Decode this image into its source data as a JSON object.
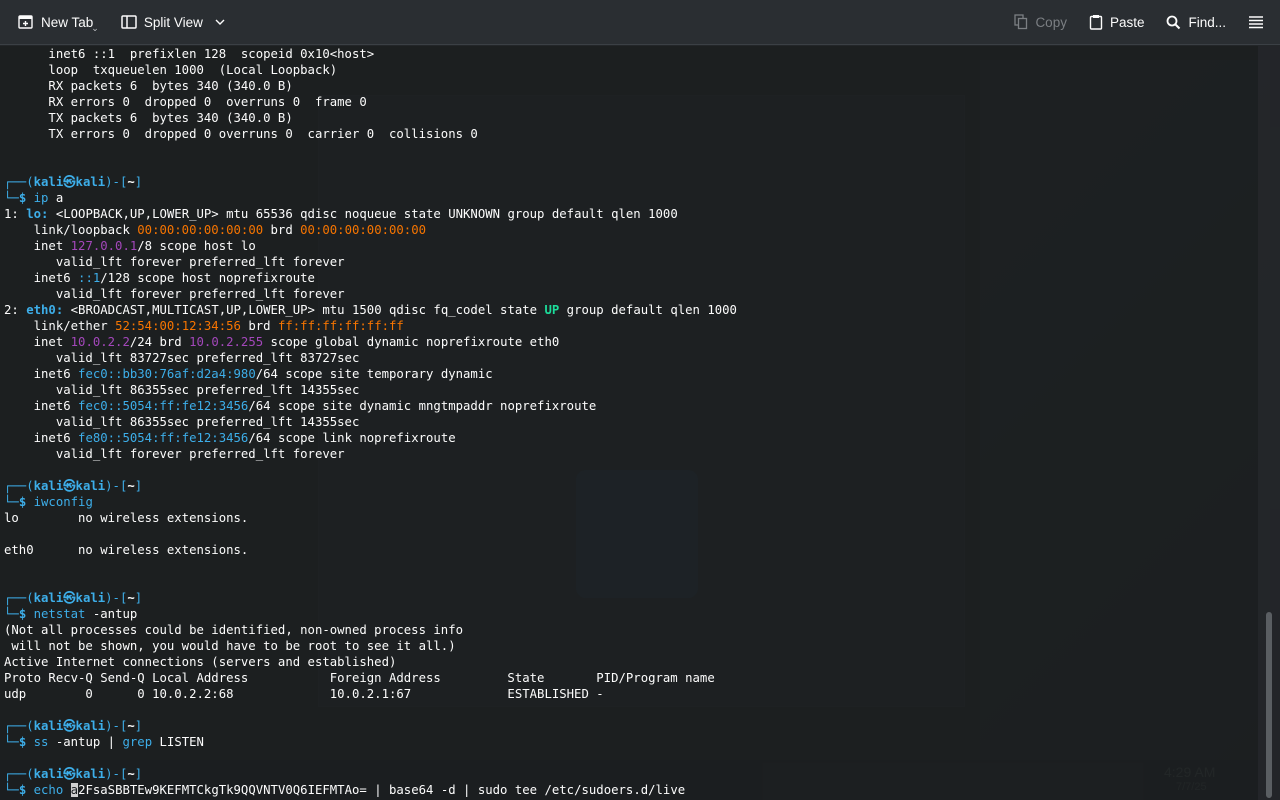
{
  "toolbar": {
    "new_tab": "New Tab",
    "split_view": "Split View",
    "copy": "Copy",
    "paste": "Paste",
    "find": "Find...",
    "icons": [
      "new-tab-icon",
      "split-view-icon",
      "chevron-down-icon",
      "copy-icon",
      "paste-icon",
      "search-icon",
      "hamburger-menu-icon"
    ]
  },
  "background": {
    "clock": "4:29 AM",
    "date": "7/7/25"
  },
  "terminal": {
    "lines": [
      [
        {
          "t": "      inet6 ::1  prefixlen 128  scopeid 0x10<host>"
        }
      ],
      [
        {
          "t": "      loop  txqueuelen 1000  (Local Loopback)"
        }
      ],
      [
        {
          "t": "      RX packets 6  bytes 340 (340.0 B)"
        }
      ],
      [
        {
          "t": "      RX errors 0  dropped 0  overruns 0  frame 0"
        }
      ],
      [
        {
          "t": "      TX packets 6  bytes 340 (340.0 B)"
        }
      ],
      [
        {
          "t": "      TX errors 0  dropped 0 overruns 0  carrier 0  collisions 0"
        }
      ],
      [
        {
          "t": ""
        }
      ],
      [
        {
          "t": ""
        }
      ],
      [
        {
          "t": "┌──(",
          "c": "c-b"
        },
        {
          "t": "kali㉿kali",
          "c": "c-bb"
        },
        {
          "t": ")-[",
          "c": "c-b"
        },
        {
          "t": "~",
          "c": "bold"
        },
        {
          "t": "]",
          "c": "c-b"
        }
      ],
      [
        {
          "t": "└─",
          "c": "c-b"
        },
        {
          "t": "$ ",
          "c": "c-bb"
        },
        {
          "t": "ip",
          "c": "c-b"
        },
        {
          "t": " a"
        }
      ],
      [
        {
          "t": "1: "
        },
        {
          "t": "lo:",
          "c": "c-bb"
        },
        {
          "t": " <LOOPBACK,UP,LOWER_UP> mtu 65536 qdisc noqueue state UNKNOWN group default qlen 1000"
        }
      ],
      [
        {
          "t": "    link/loopback "
        },
        {
          "t": "00:00:00:00:00:00",
          "c": "c-o"
        },
        {
          "t": " brd "
        },
        {
          "t": "00:00:00:00:00:00",
          "c": "c-o"
        }
      ],
      [
        {
          "t": "    inet "
        },
        {
          "t": "127.0.0.1",
          "c": "c-p"
        },
        {
          "t": "/8 scope host lo"
        }
      ],
      [
        {
          "t": "       valid_lft forever preferred_lft forever"
        }
      ],
      [
        {
          "t": "    inet6 "
        },
        {
          "t": "::1",
          "c": "c-b"
        },
        {
          "t": "/128 scope host noprefixroute"
        }
      ],
      [
        {
          "t": "       valid_lft forever preferred_lft forever"
        }
      ],
      [
        {
          "t": "2: "
        },
        {
          "t": "eth0:",
          "c": "c-bb"
        },
        {
          "t": " <BROADCAST,MULTICAST,UP,LOWER_UP> mtu 1500 qdisc fq_codel state "
        },
        {
          "t": "UP",
          "c": "c-g"
        },
        {
          "t": " group default qlen 1000"
        }
      ],
      [
        {
          "t": "    link/ether "
        },
        {
          "t": "52:54:00:12:34:56",
          "c": "c-o"
        },
        {
          "t": " brd "
        },
        {
          "t": "ff:ff:ff:ff:ff:ff",
          "c": "c-o"
        }
      ],
      [
        {
          "t": "    inet "
        },
        {
          "t": "10.0.2.2",
          "c": "c-p"
        },
        {
          "t": "/24 brd "
        },
        {
          "t": "10.0.2.255",
          "c": "c-p"
        },
        {
          "t": " scope global dynamic noprefixroute eth0"
        }
      ],
      [
        {
          "t": "       valid_lft 83727sec preferred_lft 83727sec"
        }
      ],
      [
        {
          "t": "    inet6 "
        },
        {
          "t": "fec0::bb30:76af:d2a4:980",
          "c": "c-b"
        },
        {
          "t": "/64 scope site temporary dynamic"
        }
      ],
      [
        {
          "t": "       valid_lft 86355sec preferred_lft 14355sec"
        }
      ],
      [
        {
          "t": "    inet6 "
        },
        {
          "t": "fec0::5054:ff:fe12:3456",
          "c": "c-b"
        },
        {
          "t": "/64 scope site dynamic mngtmpaddr noprefixroute"
        }
      ],
      [
        {
          "t": "       valid_lft 86355sec preferred_lft 14355sec"
        }
      ],
      [
        {
          "t": "    inet6 "
        },
        {
          "t": "fe80::5054:ff:fe12:3456",
          "c": "c-b"
        },
        {
          "t": "/64 scope link noprefixroute"
        }
      ],
      [
        {
          "t": "       valid_lft forever preferred_lft forever"
        }
      ],
      [
        {
          "t": ""
        }
      ],
      [
        {
          "t": "┌──(",
          "c": "c-b"
        },
        {
          "t": "kali㉿kali",
          "c": "c-bb"
        },
        {
          "t": ")-[",
          "c": "c-b"
        },
        {
          "t": "~",
          "c": "bold"
        },
        {
          "t": "]",
          "c": "c-b"
        }
      ],
      [
        {
          "t": "└─",
          "c": "c-b"
        },
        {
          "t": "$ ",
          "c": "c-bb"
        },
        {
          "t": "iwconfig",
          "c": "c-b"
        }
      ],
      [
        {
          "t": "lo        no wireless extensions."
        }
      ],
      [
        {
          "t": ""
        }
      ],
      [
        {
          "t": "eth0      no wireless extensions."
        }
      ],
      [
        {
          "t": ""
        }
      ],
      [
        {
          "t": ""
        }
      ],
      [
        {
          "t": "┌──(",
          "c": "c-b"
        },
        {
          "t": "kali㉿kali",
          "c": "c-bb"
        },
        {
          "t": ")-[",
          "c": "c-b"
        },
        {
          "t": "~",
          "c": "bold"
        },
        {
          "t": "]",
          "c": "c-b"
        }
      ],
      [
        {
          "t": "└─",
          "c": "c-b"
        },
        {
          "t": "$ ",
          "c": "c-bb"
        },
        {
          "t": "netstat",
          "c": "c-b"
        },
        {
          "t": " -antup"
        }
      ],
      [
        {
          "t": "(Not all processes could be identified, non-owned process info"
        }
      ],
      [
        {
          "t": " will not be shown, you would have to be root to see it all.)"
        }
      ],
      [
        {
          "t": "Active Internet connections (servers and established)"
        }
      ],
      [
        {
          "t": "Proto Recv-Q Send-Q Local Address           Foreign Address         State       PID/Program name"
        }
      ],
      [
        {
          "t": "udp        0      0 10.0.2.2:68             10.0.2.1:67             ESTABLISHED -"
        }
      ],
      [
        {
          "t": ""
        }
      ],
      [
        {
          "t": "┌──(",
          "c": "c-b"
        },
        {
          "t": "kali㉿kali",
          "c": "c-bb"
        },
        {
          "t": ")-[",
          "c": "c-b"
        },
        {
          "t": "~",
          "c": "bold"
        },
        {
          "t": "]",
          "c": "c-b"
        }
      ],
      [
        {
          "t": "└─",
          "c": "c-b"
        },
        {
          "t": "$ ",
          "c": "c-bb"
        },
        {
          "t": "ss",
          "c": "c-b"
        },
        {
          "t": " -antup | "
        },
        {
          "t": "grep",
          "c": "c-b"
        },
        {
          "t": " LISTEN"
        }
      ],
      [
        {
          "t": ""
        }
      ],
      [
        {
          "t": "┌──(",
          "c": "c-b"
        },
        {
          "t": "kali㉿kali",
          "c": "c-bb"
        },
        {
          "t": ")-[",
          "c": "c-b"
        },
        {
          "t": "~",
          "c": "bold"
        },
        {
          "t": "]",
          "c": "c-b"
        }
      ],
      [
        {
          "t": "└─",
          "c": "c-b"
        },
        {
          "t": "$ ",
          "c": "c-bb"
        },
        {
          "t": "echo",
          "c": "c-b"
        },
        {
          "t": " "
        },
        {
          "t": "a",
          "c": "cursor"
        },
        {
          "t": "2FsaSBBTEw9KEFMTCkgTk9QQVNTV0Q6IEFMTAo= | base64 -d | sudo tee /etc/sudoers.d/live"
        }
      ]
    ]
  }
}
